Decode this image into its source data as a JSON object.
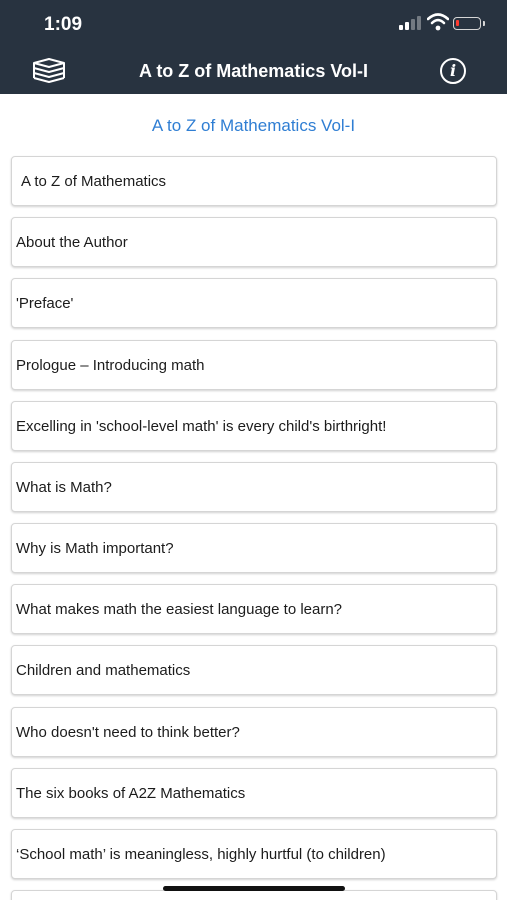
{
  "status_bar": {
    "time": "1:09",
    "battery_level": 0.15
  },
  "nav": {
    "title": "A to Z of Mathematics Vol-I",
    "menu_icon": "book-stack-icon",
    "info_button": "i",
    "info_icon": "info-icon"
  },
  "content": {
    "heading": "A to Z of Mathematics Vol-I",
    "items": [
      "A to Z of Mathematics",
      "About the Author",
      "'Preface'",
      "Prologue – Introducing math",
      "Excelling in 'school-level math' is every child's birthright!",
      "What is Math?",
      "Why is Math important?",
      "What makes math the easiest language to learn?",
      "Children and mathematics",
      "Who doesn't need to think better?",
      "The six books of A2Z Mathematics",
      "‘School math’ is meaningless, highly hurtful (to children)"
    ]
  },
  "colors": {
    "nav_background": "#283340",
    "accent": "#2f7ed3",
    "battery_low": "#ff3b30"
  }
}
